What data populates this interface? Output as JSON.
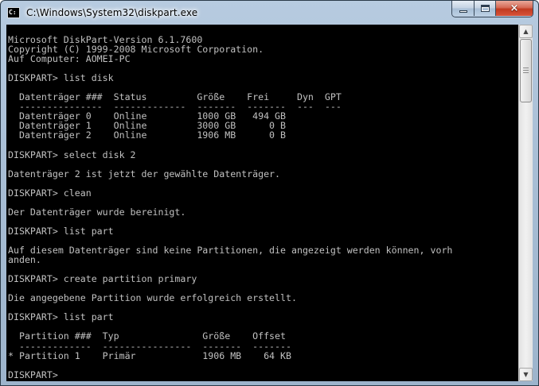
{
  "window": {
    "title": "C:\\Windows\\System32\\diskpart.exe",
    "controls": {
      "minimize": "minimize",
      "maximize": "maximize",
      "close": "×"
    }
  },
  "console": {
    "lines": [
      "Microsoft DiskPart-Version 6.1.7600",
      "Copyright (C) 1999-2008 Microsoft Corporation.",
      "Auf Computer: AOMEI-PC",
      "",
      "DISKPART> list disk",
      "",
      "  Datenträger ###  Status         Größe    Frei     Dyn  GPT",
      "  ---------------  -------------  -------  -------  ---  ---",
      "  Datenträger 0    Online         1000 GB   494 GB",
      "  Datenträger 1    Online         3000 GB      0 B",
      "  Datenträger 2    Online         1906 MB      0 B",
      "",
      "DISKPART> select disk 2",
      "",
      "Datenträger 2 ist jetzt der gewählte Datenträger.",
      "",
      "DISKPART> clean",
      "",
      "Der Datenträger wurde bereinigt.",
      "",
      "DISKPART> list part",
      "",
      "Auf diesem Datenträger sind keine Partitionen, die angezeigt werden können, vorh",
      "anden.",
      "",
      "DISKPART> create partition primary",
      "",
      "Die angegebene Partition wurde erfolgreich erstellt.",
      "",
      "DISKPART> list part",
      "",
      "  Partition ###  Typ               Größe    Offset",
      "  -------------  ----------------  -------  -------",
      "* Partition 1    Primär            1906 MB    64 KB",
      "",
      "DISKPART> "
    ]
  },
  "colors": {
    "console_bg": "#000000",
    "console_fg": "#c0c0c0",
    "close_button": "#c13a20"
  }
}
